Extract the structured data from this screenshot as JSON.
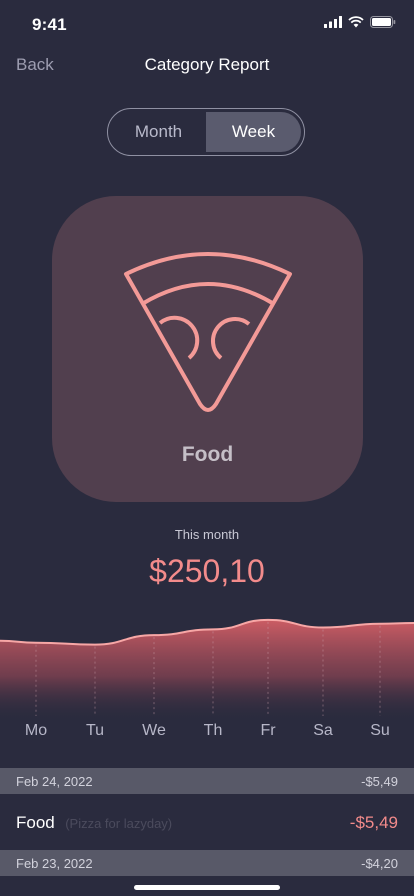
{
  "status": {
    "time": "9:41"
  },
  "nav": {
    "back_label": "Back",
    "title": "Category Report"
  },
  "toggle": {
    "options": [
      "Month",
      "Week"
    ],
    "selected": "Week"
  },
  "category": {
    "name": "Food",
    "icon": "pizza-icon"
  },
  "summary": {
    "period_label": "This month",
    "amount": "$250,10"
  },
  "chart_data": {
    "type": "area",
    "categories": [
      "Mo",
      "Tu",
      "We",
      "Th",
      "Fr",
      "Sa",
      "Su"
    ],
    "series": [
      {
        "values": [
          0.35,
          0.3,
          0.55,
          0.7,
          0.95,
          0.75,
          0.85
        ]
      }
    ]
  },
  "transactions": [
    {
      "date": "Feb 24, 2022",
      "date_total": "-$5,49",
      "category": "Food",
      "note": "(Pizza for lazyday)",
      "amount": "-$5,49"
    },
    {
      "date": "Feb 23, 2022",
      "date_total": "-$4,20"
    }
  ],
  "colors": {
    "background": "#2a2b3e",
    "accent": "#f38b8b",
    "card": "#513f4e"
  }
}
